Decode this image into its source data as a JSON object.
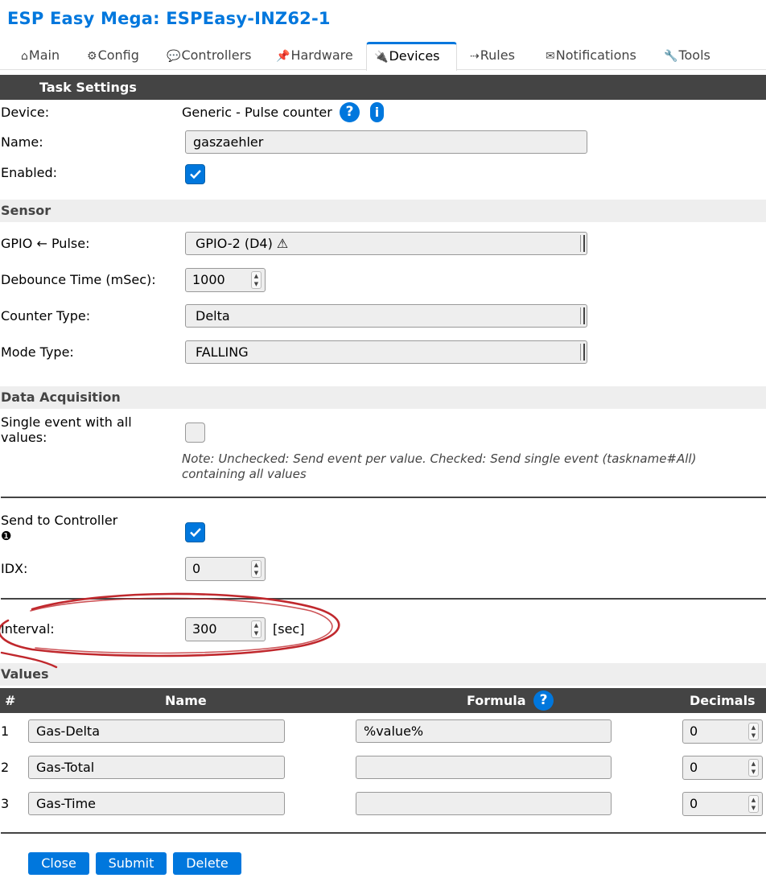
{
  "app_title": "ESP Easy Mega: ESPEasy-INZ62-1",
  "tabs": [
    {
      "icon": "⌂",
      "label": "Main"
    },
    {
      "icon": "⚙",
      "label": "Config"
    },
    {
      "icon": "💬",
      "label": "Controllers"
    },
    {
      "icon": "📌",
      "label": "Hardware"
    },
    {
      "icon": "🔌",
      "label": "Devices"
    },
    {
      "icon": "⇢",
      "label": "Rules"
    },
    {
      "icon": "✉",
      "label": "Notifications"
    },
    {
      "icon": "🔧",
      "label": "Tools"
    }
  ],
  "active_tab": "Devices",
  "task_settings": {
    "header": "Task Settings",
    "device_label": "Device:",
    "device_value": "Generic - Pulse counter",
    "help_icon": "?",
    "info_icon": "i",
    "name_label": "Name:",
    "name_value": "gaszaehler",
    "enabled_label": "Enabled:",
    "enabled": true
  },
  "sensor": {
    "header": "Sensor",
    "gpio_label": "GPIO ← Pulse:",
    "gpio_value": "GPIO-2 (D4) ⚠",
    "debounce_label": "Debounce Time (mSec):",
    "debounce_value": "1000",
    "counter_type_label": "Counter Type:",
    "counter_type_value": "Delta",
    "mode_type_label": "Mode Type:",
    "mode_type_value": "FALLING"
  },
  "data_acquisition": {
    "header": "Data Acquisition",
    "single_event_label_1": "Single event with all",
    "single_event_label_2": "values:",
    "single_event": false,
    "note_1": "Note: Unchecked: Send event per value. Checked: Send single event (taskname#All)",
    "note_2": "containing all values",
    "send_controller_label": "Send to Controller",
    "send_controller_index": "❶",
    "send_controller": true,
    "idx_label": "IDX:",
    "idx_value": "0",
    "interval_label": "Interval:",
    "interval_value": "300",
    "interval_unit": "[sec]"
  },
  "values": {
    "header": "Values",
    "columns": {
      "index": "#",
      "name": "Name",
      "formula": "Formula",
      "decimals": "Decimals"
    },
    "rows": [
      {
        "index": "1",
        "name": "Gas-Delta",
        "formula": "%value%",
        "decimals": "0"
      },
      {
        "index": "2",
        "name": "Gas-Total",
        "formula": "",
        "decimals": "0"
      },
      {
        "index": "3",
        "name": "Gas-Time",
        "formula": "",
        "decimals": "0"
      }
    ]
  },
  "buttons": {
    "close": "Close",
    "submit": "Submit",
    "delete": "Delete"
  },
  "colors": {
    "accent": "#0077dd",
    "header_bg": "#444444",
    "annotation": "#c0282d"
  }
}
